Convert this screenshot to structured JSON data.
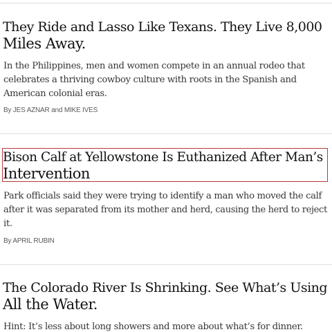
{
  "stories": [
    {
      "headline_line1": "They Ride and Lasso Like Texans. They Live 8,000",
      "headline_line2": "Miles Away.",
      "summary_line1": "In the Philippines, men and women compete in an annual rodeo that",
      "summary_line2": "celebrates a thriving cowboy culture with roots in the Spanish and",
      "summary_line3": "American colonial eras.",
      "byline_prefix": "By",
      "author_1": "JES AZNAR",
      "byline_and": "and",
      "author_2": "MIKE IVES"
    },
    {
      "headline_line1": "Bison Calf at Yellowstone Is Euthanized After Man’s",
      "headline_line2": "Intervention",
      "summary_line1": "Park officials said they were trying to identify a man who moved the calf",
      "summary_line2": "after it was separated from its mother and herd, causing the herd to reject",
      "summary_line3": "it.",
      "byline_prefix": "By",
      "author_1": "APRIL RUBIN"
    },
    {
      "headline_line1": "The Colorado River Is Shrinking. See What’s Using",
      "headline_line2": "All the Water.",
      "summary_line1": "Hint: It’s less about long showers and more about what’s for dinner."
    }
  ],
  "colors": {
    "headline": "#121212",
    "summary": "#363636",
    "byline": "#5a5a5a",
    "divider": "#dfdfdf",
    "focus_outline": "#b5393c"
  }
}
